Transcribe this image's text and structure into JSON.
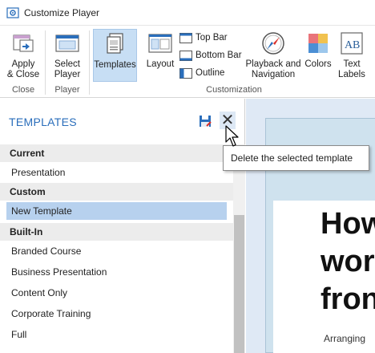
{
  "window": {
    "title": "Customize Player"
  },
  "ribbon": {
    "apply_close": "Apply\n& Close",
    "select_player": "Select\nPlayer",
    "templates": "Templates",
    "layout": "Layout",
    "top_bar": "Top Bar",
    "bottom_bar": "Bottom Bar",
    "outline": "Outline",
    "playback_navigation": "Playback and\nNavigation",
    "colors": "Colors",
    "text_labels": "Text\nLabels",
    "groups": {
      "close": "Close",
      "player": "Player",
      "customization": "Customization"
    }
  },
  "panel": {
    "title": "TEMPLATES",
    "sections": [
      {
        "label": "Current",
        "items": [
          "Presentation"
        ]
      },
      {
        "label": "Custom",
        "items": [
          "New Template"
        ]
      },
      {
        "label": "Built-In",
        "items": [
          "Branded Course",
          "Business Presentation",
          "Content Only",
          "Corporate Training",
          "Full"
        ]
      }
    ],
    "selected_item": "New Template"
  },
  "tooltip": {
    "text": "Delete the selected template"
  },
  "preview": {
    "headline": "How\nwor\nfron",
    "subline": "Arranging"
  },
  "colors": {
    "accent": "#2a6ebb",
    "selected": "#b7d1ee",
    "active_tab": "#c7def4"
  }
}
